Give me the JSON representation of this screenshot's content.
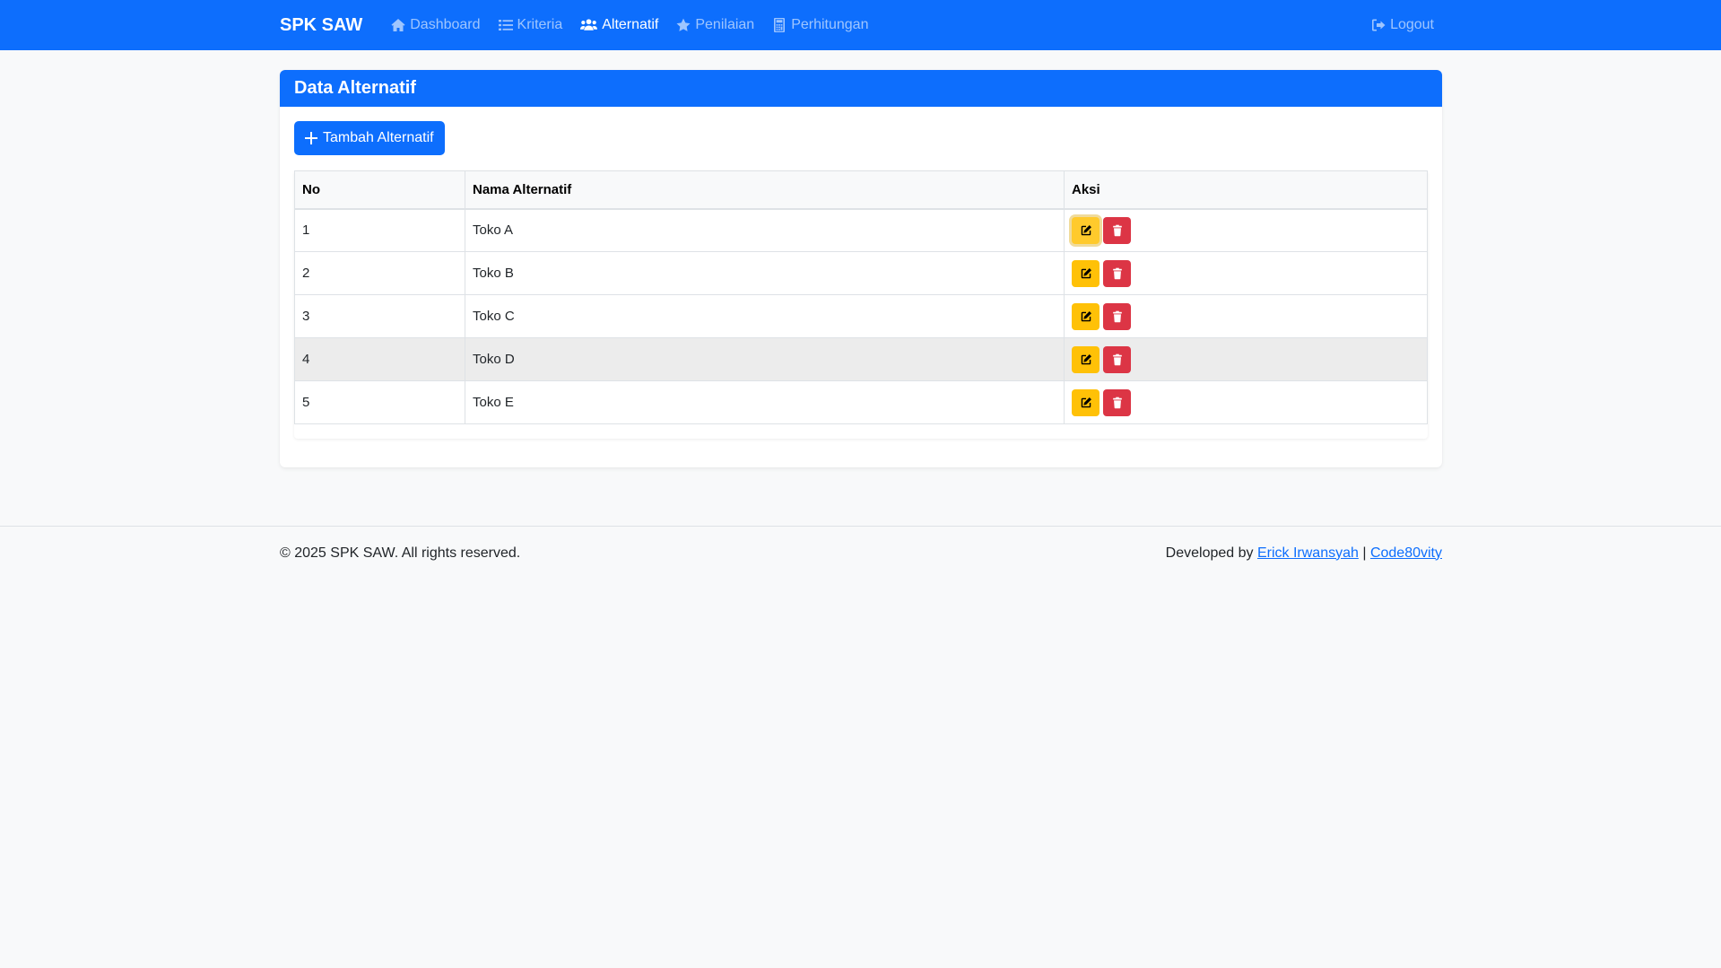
{
  "navbar": {
    "brand": "SPK SAW",
    "links": [
      {
        "label": "Dashboard",
        "icon": "home-icon"
      },
      {
        "label": "Kriteria",
        "icon": "list-icon"
      },
      {
        "label": "Alternatif",
        "icon": "users-icon",
        "active": true
      },
      {
        "label": "Penilaian",
        "icon": "star-icon"
      },
      {
        "label": "Perhitungan",
        "icon": "calculator-icon"
      }
    ],
    "logout": "Logout"
  },
  "card": {
    "title": "Data Alternatif",
    "add_button": "Tambah Alternatif"
  },
  "table": {
    "headers": [
      "No",
      "Nama Alternatif",
      "Aksi"
    ],
    "rows": [
      {
        "no": "1",
        "nama": "Toko A"
      },
      {
        "no": "2",
        "nama": "Toko B"
      },
      {
        "no": "3",
        "nama": "Toko C"
      },
      {
        "no": "4",
        "nama": "Toko D"
      },
      {
        "no": "5",
        "nama": "Toko E"
      }
    ]
  },
  "footer": {
    "copyright": "© 2025 SPK SAW. All rights reserved.",
    "developed_by": "Developed by",
    "author_link": "Erick Irwansyah",
    "separator": "|",
    "org_link": "Code80vity"
  },
  "colors": {
    "primary": "#0d6efd",
    "warning": "#ffc107",
    "danger": "#dc3545"
  }
}
